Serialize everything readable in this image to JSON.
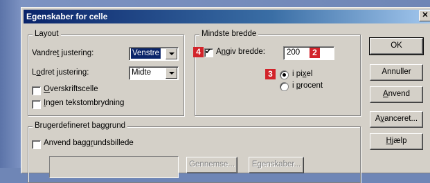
{
  "window": {
    "title": "Egenskaber for celle",
    "close_label": "✕"
  },
  "layout": {
    "legend": "Layout",
    "halign": {
      "label_pre": "Vandre",
      "label_u": "t",
      "label_post": " justering:",
      "value": "Venstre"
    },
    "valign": {
      "label_pre": "L",
      "label_u": "o",
      "label_post": "dret justering:",
      "value": "Midte"
    },
    "header_cell": {
      "label_u": "O",
      "label_post": "verskriftscelle",
      "checked": false
    },
    "no_wrap": {
      "label_u": "I",
      "label_post": "ngen tekstombrydning",
      "checked": false
    }
  },
  "min_width": {
    "legend": "Mindste bredde",
    "specify": {
      "label_pre": "A",
      "label_u": "n",
      "label_post": "giv bredde:",
      "checked": true
    },
    "value": "200",
    "pixel": {
      "label_pre": "i pi",
      "label_u": "x",
      "label_post": "el",
      "checked": true
    },
    "percent": {
      "label_pre": "i ",
      "label_u": "p",
      "label_post": "rocent",
      "checked": false
    }
  },
  "background": {
    "legend": "Brugerdefineret baggrund",
    "use_image": {
      "label_pre": "Anvend bagg",
      "label_u": "r",
      "label_post": "undsbillede",
      "checked": false
    },
    "browse_label": "Gennemse...",
    "properties_label": "Egenskaber..."
  },
  "buttons": {
    "ok": "OK",
    "cancel": "Annuller",
    "apply_u": "A",
    "apply_post": "nvend",
    "advanced_pre": "A",
    "advanced_u": "v",
    "advanced_post": "anceret...",
    "help_u": "H",
    "help_post": "jælp"
  },
  "badges": {
    "b4": "4",
    "b2": "2",
    "b3": "3"
  },
  "colors": {
    "badge": "#d2232a",
    "titlebar": "#0a246a",
    "dialog": "#d4d0c8"
  }
}
